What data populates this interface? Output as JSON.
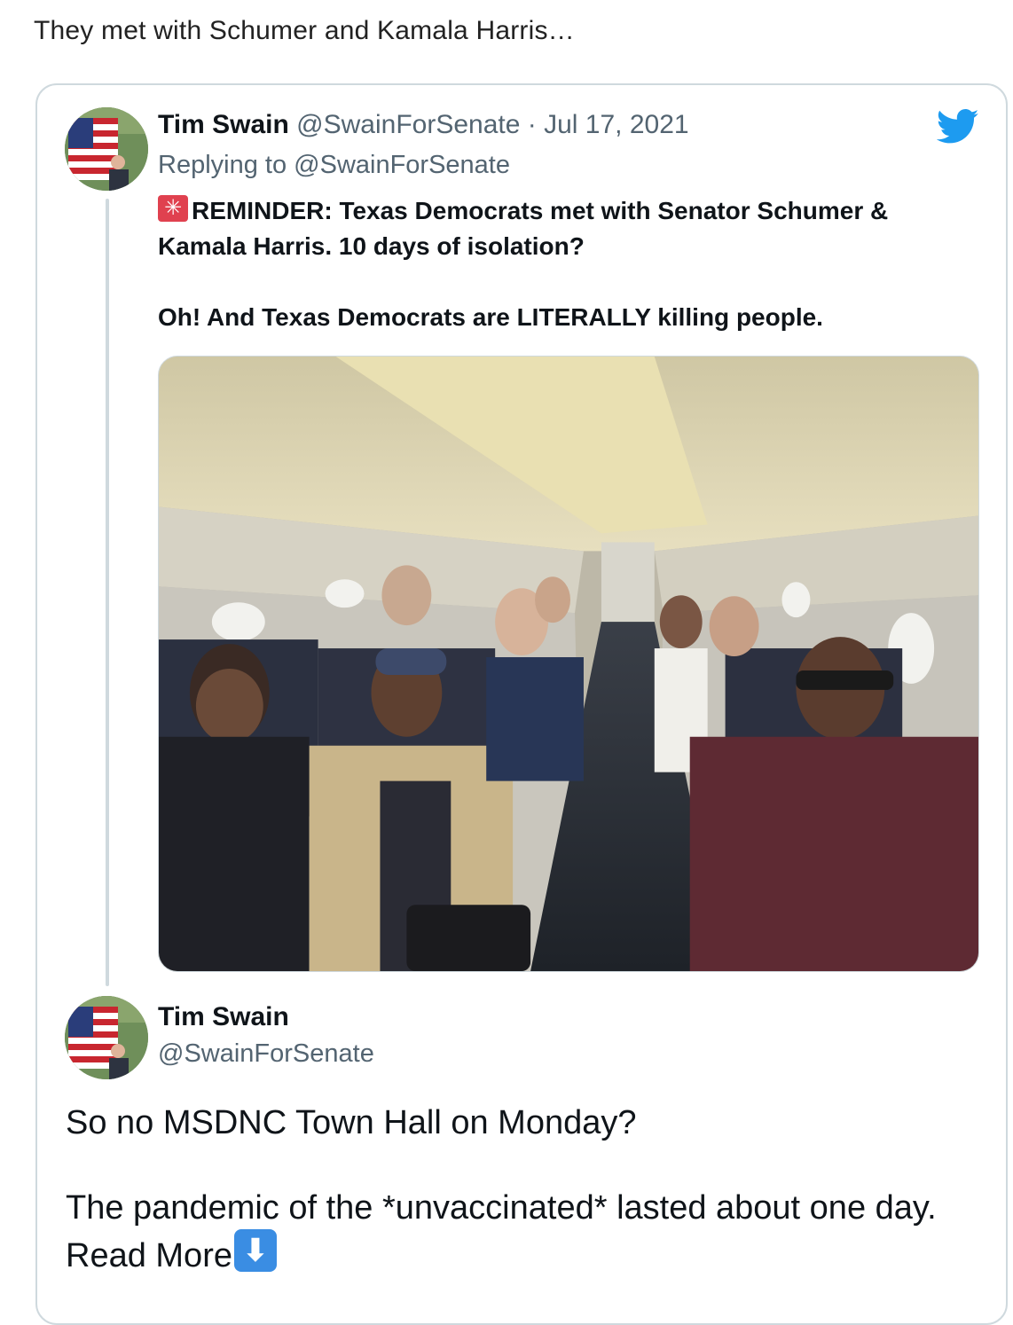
{
  "intro_text": "They met with Schumer and Kamala Harris…",
  "tweet": {
    "author_name": "Tim Swain",
    "author_handle": "@SwainForSenate",
    "separator": "·",
    "date": "Jul 17, 2021",
    "replying_prefix": "Replying to",
    "replying_handle": "@SwainForSenate",
    "text_line1": "REMINDER: Texas Democrats met with Senator Schumer & Kamala Harris. 10 days of isolation?",
    "text_line2": "Oh! And Texas Democrats are LITERALLY killing people.",
    "siren_emoji": "siren-emoji",
    "photo": "airplane-cabin-photo"
  },
  "reply": {
    "author_name": "Tim Swain",
    "author_handle": "@SwainForSenate",
    "text_line1": "So no MSDNC Town Hall on Monday?",
    "text_line2": "The pandemic of the *unvaccinated* lasted about one day. Read More",
    "arrow_emoji": "down-arrow-emoji"
  },
  "colors": {
    "twitter_blue": "#1d9bf0",
    "muted_text": "#536471",
    "border": "#cfd9de"
  }
}
